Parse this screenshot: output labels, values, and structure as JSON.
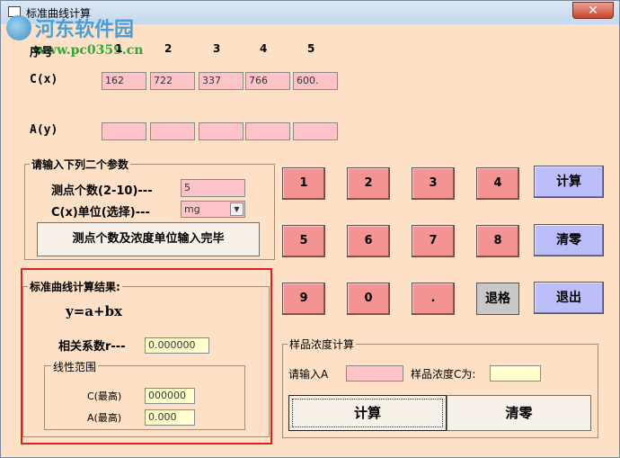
{
  "window": {
    "title": "标准曲线计算",
    "close_label": "✕"
  },
  "watermark": {
    "site_name": "河东软件园",
    "url": "www.pc0359.cn"
  },
  "table": {
    "index_label": "序号",
    "indices": [
      "1",
      "2",
      "3",
      "4",
      "5"
    ],
    "cx_label": "C(x)",
    "cx_values": [
      "162",
      "722",
      "337",
      "766",
      "600."
    ],
    "ay_label": "A(y)",
    "ay_values": [
      "",
      "",
      "",
      "",
      ""
    ]
  },
  "params": {
    "title": "请输入下列二个参数",
    "points_label": "测点个数(2-10)---",
    "points_value": "5",
    "unit_label": "C(x)单位(选择)---",
    "unit_value": "mg",
    "confirm_label": "测点个数及浓度单位输入完毕"
  },
  "keypad": {
    "row1": [
      "1",
      "2",
      "3",
      "4"
    ],
    "row2": [
      "5",
      "6",
      "7",
      "8"
    ],
    "row3": [
      "9",
      "0",
      "."
    ],
    "calc_label": "计算",
    "clear_label": "清零",
    "backspace_label": "退格",
    "exit_label": "退出"
  },
  "result": {
    "title": "标准曲线计算结果:",
    "equation": "y=a+bx",
    "corr_label": "相关系数r---",
    "corr_value": "0.000000",
    "range_title": "线性范围",
    "c_label": "C(最高)",
    "c_value": "000000",
    "a_label": "A(最高)",
    "a_value": "0.000"
  },
  "sample": {
    "title": "样品浓度计算",
    "input_label": "请输入A",
    "input_value": "",
    "output_label": "样品浓度C为:",
    "output_value": "",
    "calc_label": "计算",
    "clear_label": "清零"
  }
}
